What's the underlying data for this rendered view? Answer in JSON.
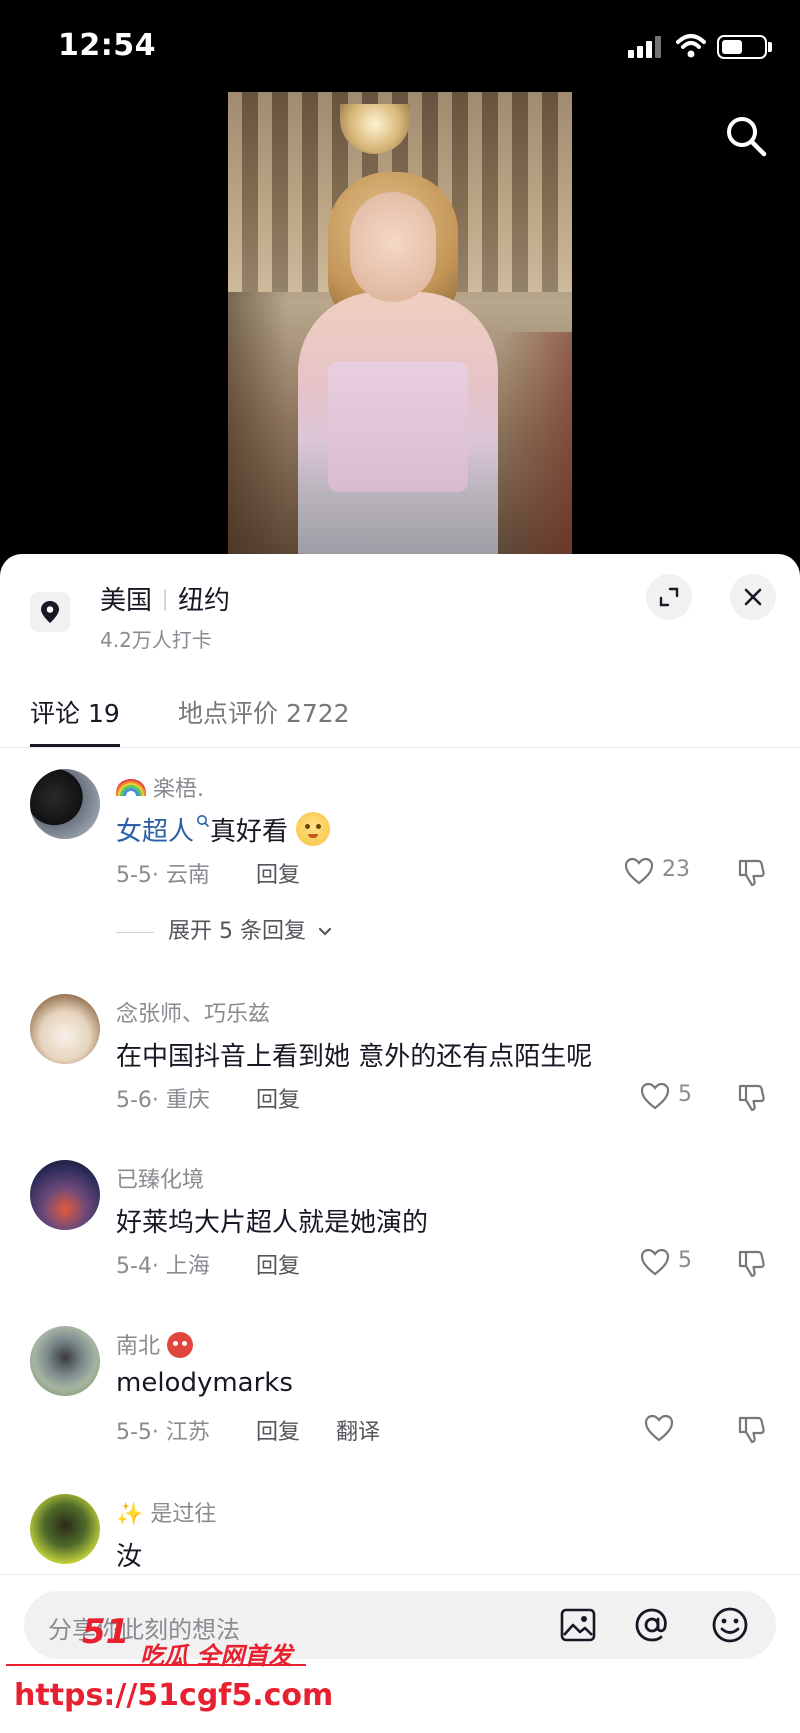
{
  "status_bar": {
    "time": "12:54"
  },
  "location": {
    "country": "美国",
    "city": "纽约",
    "checkins": "4.2万人打卡"
  },
  "tabs": [
    {
      "label": "评论 19",
      "active": true
    },
    {
      "label": "地点评价 2722",
      "active": false
    }
  ],
  "comments": [
    {
      "username": "楽梧.",
      "text_link": "女超人",
      "text": "真好看",
      "date_region": "5-5· 云南",
      "reply_label": "回复",
      "likes": "23",
      "expand_replies": "展开 5 条回复"
    },
    {
      "username": "念张师、巧乐兹",
      "text": "在中国抖音上看到她 意外的还有点陌生呢",
      "date_region": "5-6· 重庆",
      "reply_label": "回复",
      "likes": "5"
    },
    {
      "username": "已臻化境",
      "text": "好莱坞大片超人就是她演的",
      "date_region": "5-4· 上海",
      "reply_label": "回复",
      "likes": "5"
    },
    {
      "username": "南北",
      "text": "melodymarks",
      "date_region": "5-5· 江苏",
      "reply_label": "回复",
      "translate_label": "翻译",
      "likes": ""
    },
    {
      "username": "是过往",
      "text": "汝"
    }
  ],
  "input": {
    "placeholder": "分享你此刻的想法"
  },
  "watermark": {
    "logo": "51",
    "slogan": "吃瓜 全网首发",
    "url": "https://51cgf5.com"
  },
  "colors": {
    "accent_link": "#2b5fa6",
    "watermark": "#e8202f"
  }
}
